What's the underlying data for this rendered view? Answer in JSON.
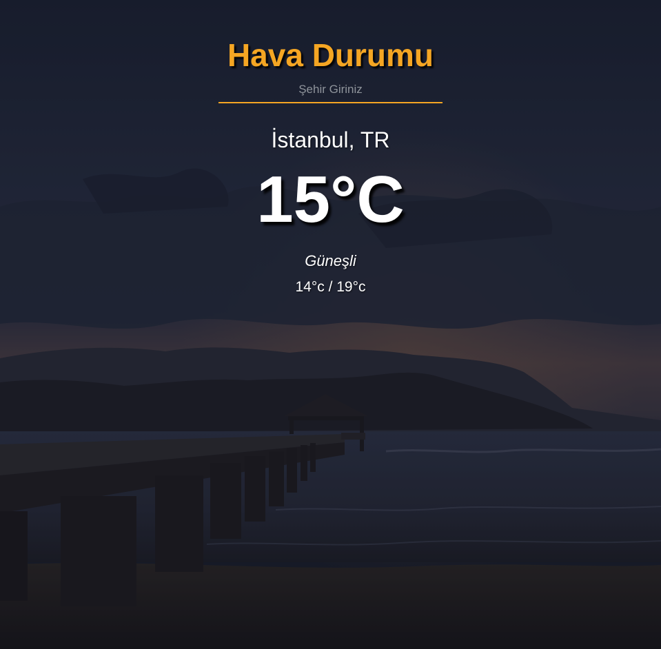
{
  "app": {
    "title": "Hava Durumu",
    "accent_color": "#f5a623"
  },
  "search": {
    "placeholder": "Şehir Giriniz",
    "value": ""
  },
  "weather": {
    "location": "İstanbul, TR",
    "temperature": "15°C",
    "description": "Güneşli",
    "range": "14°c / 19°c"
  },
  "background": {
    "icon": "sunset-pier-scene-image"
  }
}
